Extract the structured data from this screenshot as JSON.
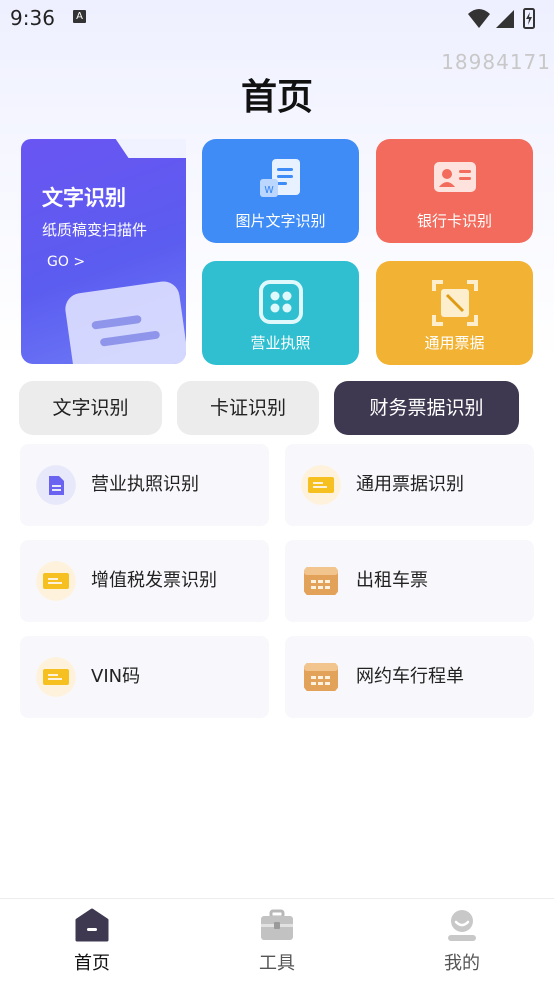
{
  "status": {
    "time": "9:36",
    "notif_badge": "A",
    "phone_number": "18984171"
  },
  "header": {
    "title": "首页"
  },
  "feature_cards": {
    "main": {
      "title": "文字识别",
      "subtitle": "纸质稿变扫描件",
      "go_label": "GO",
      "go_arrow": ">"
    },
    "image_text": {
      "label": "图片文字识别",
      "icon": "document-word-icon",
      "color": "#3f8cf7"
    },
    "bank_card": {
      "label": "银行卡识别",
      "icon": "id-card-icon",
      "color": "#f26b5c"
    },
    "business_license": {
      "label": "营业执照",
      "icon": "scan-frame-icon",
      "color": "#2fbfd0"
    },
    "general_ticket": {
      "label": "通用票据",
      "icon": "ticket-scan-icon",
      "color": "#f2b233"
    }
  },
  "tabs": [
    {
      "label": "文字识别",
      "active": false
    },
    {
      "label": "卡证识别",
      "active": false
    },
    {
      "label": "财务票据识别",
      "active": true
    }
  ],
  "list": [
    {
      "label": "营业执照识别",
      "icon": "file-icon"
    },
    {
      "label": "通用票据识别",
      "icon": "ticket-icon"
    },
    {
      "label": "增值税发票识别",
      "icon": "ticket-icon"
    },
    {
      "label": "出租车票",
      "icon": "receipt-icon"
    },
    {
      "label": "VIN码",
      "icon": "ticket-icon"
    },
    {
      "label": "网约车行程单",
      "icon": "receipt-icon"
    }
  ],
  "bottom_nav": [
    {
      "label": "首页",
      "icon": "home-icon",
      "active": true
    },
    {
      "label": "工具",
      "icon": "briefcase-icon",
      "active": false
    },
    {
      "label": "我的",
      "icon": "user-icon",
      "active": false
    }
  ],
  "colors": {
    "accent": "#5b5cf0",
    "active_tab": "#3e3950",
    "nav_active": "#3e3950",
    "nav_inactive": "#9a9a9a"
  }
}
